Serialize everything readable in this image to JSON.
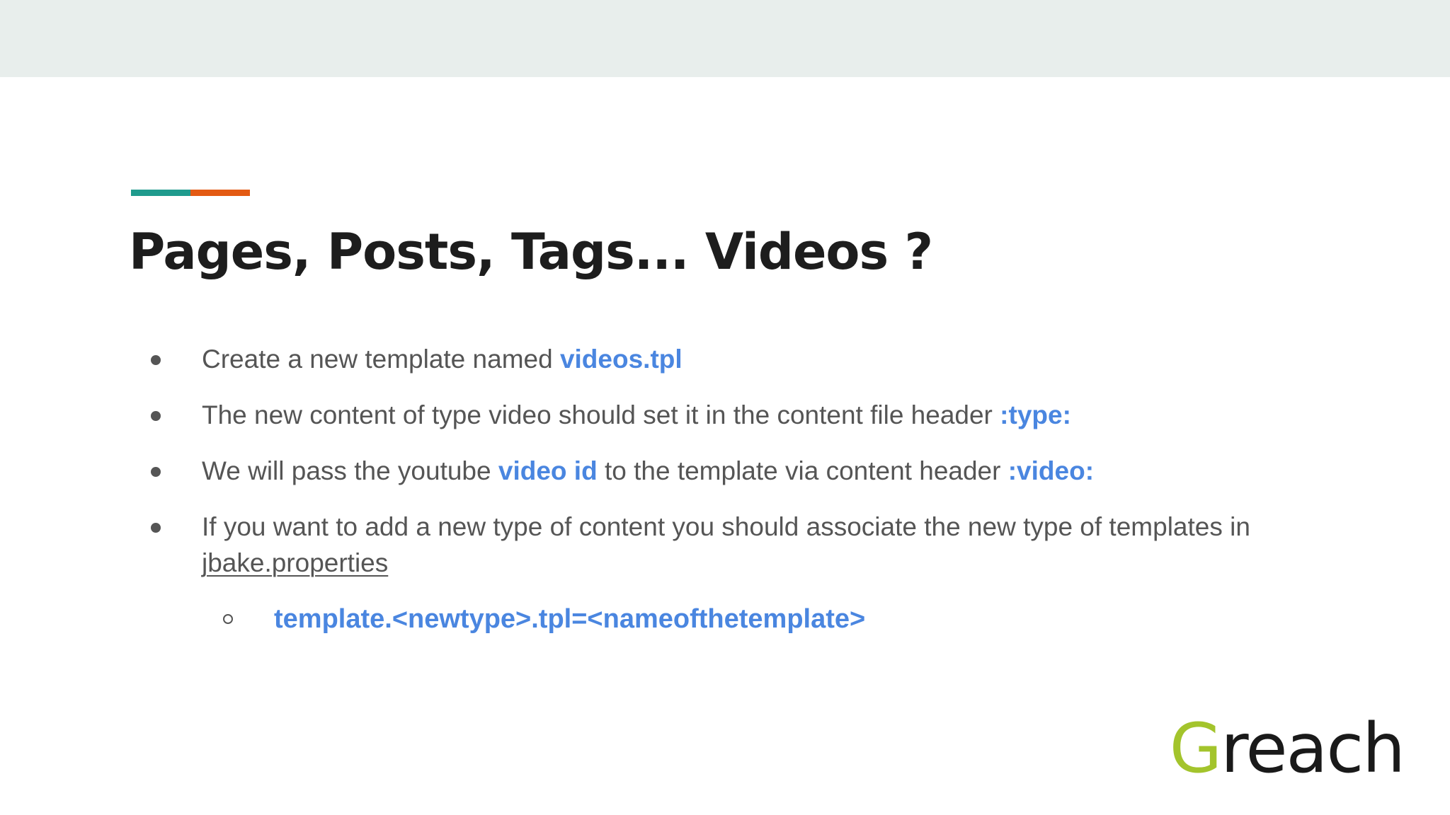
{
  "colors": {
    "accent_teal": "#1f9b8d",
    "accent_orange": "#e35a13",
    "highlight_blue": "#4a86e0",
    "body_text": "#555555",
    "title_text": "#1d1d1d",
    "logo_green": "#a3c42c",
    "top_bar": "#e8eeec"
  },
  "slide": {
    "title": "Pages, Posts, Tags... Videos ?",
    "bullets": [
      {
        "pre": "Create a new template named ",
        "hl": "videos.tpl",
        "post": ""
      },
      {
        "pre": "The new content of type video should set it in the content file header ",
        "hl": ":type:",
        "post": ""
      },
      {
        "pre": "We will pass the youtube ",
        "hl": "video id",
        "mid": " to the template via content header ",
        "hl2": ":video:"
      },
      {
        "line1": "If you want to add a new type  of content you should associate the new type of templates in",
        "line2": "jbake.properties"
      }
    ],
    "sub_bullet": "template.<newtype>.tpl=<nameofthetemplate>"
  },
  "logo": {
    "first_letter": "G",
    "rest": "reach"
  }
}
